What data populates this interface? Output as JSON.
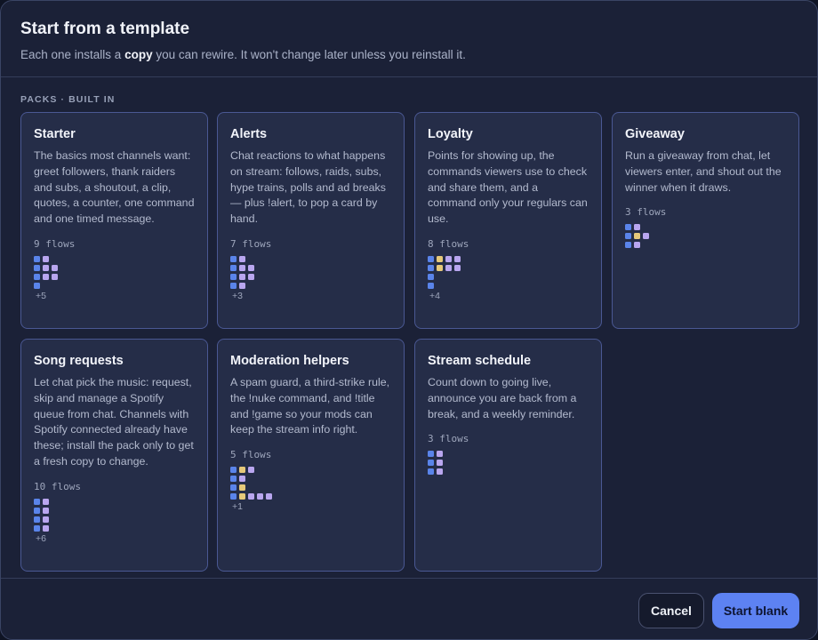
{
  "header": {
    "title": "Start from a template",
    "subtitle_prefix": "Each one installs a ",
    "subtitle_bold": "copy",
    "subtitle_suffix": " you can rewire. It won't change later unless you reinstall it."
  },
  "section": {
    "label": "PACKS · BUILT IN"
  },
  "cards": [
    {
      "name": "Starter",
      "desc": "The basics most channels want: greet followers, thank raiders and subs, a shoutout, a clip, quotes, a counter, one command and one timed message.",
      "count": "9 flows",
      "dots": [
        "bl",
        "bll",
        "bll",
        "b"
      ],
      "more": "+5"
    },
    {
      "name": "Alerts",
      "desc": "Chat reactions to what happens on stream: follows, raids, subs, hype trains, polls and ad breaks — plus !alert, to pop a card by hand.",
      "count": "7 flows",
      "dots": [
        "bl",
        "bll",
        "bll",
        "bl"
      ],
      "more": "+3"
    },
    {
      "name": "Loyalty",
      "desc": "Points for showing up, the commands viewers use to check and share them, and a command only your regulars can use.",
      "count": "8 flows",
      "dots": [
        "byll",
        "byll",
        "b",
        "b"
      ],
      "more": "+4"
    },
    {
      "name": "Giveaway",
      "desc": "Run a giveaway from chat, let viewers enter, and shout out the winner when it draws.",
      "count": "3 flows",
      "dots": [
        "bl",
        "byl",
        "bl"
      ],
      "more": ""
    },
    {
      "name": "Song requests",
      "desc": "Let chat pick the music: request, skip and manage a Spotify queue from chat. Channels with Spotify connected already have these; install the pack only to get a fresh copy to change.",
      "count": "10 flows",
      "dots": [
        "bl",
        "bl",
        "bl",
        "bl"
      ],
      "more": "+6"
    },
    {
      "name": "Moderation helpers",
      "desc": "A spam guard, a third-strike rule, the !nuke command, and !title and !game so your mods can keep the stream info right.",
      "count": "5 flows",
      "dots": [
        "byl",
        "bl",
        "by",
        "bylll"
      ],
      "more": "+1"
    },
    {
      "name": "Stream schedule",
      "desc": "Count down to going live, announce you are back from a break, and a weekly reminder.",
      "count": "3 flows",
      "dots": [
        "bl",
        "bl",
        "bl"
      ],
      "more": ""
    }
  ],
  "footer": {
    "cancel_label": "Cancel",
    "primary_label": "Start blank"
  },
  "colors": {
    "accent": "#5d82f2",
    "dot_blue": "#5a84ea",
    "dot_lilac": "#b9a6ef",
    "dot_yellow": "#e6c97a"
  }
}
